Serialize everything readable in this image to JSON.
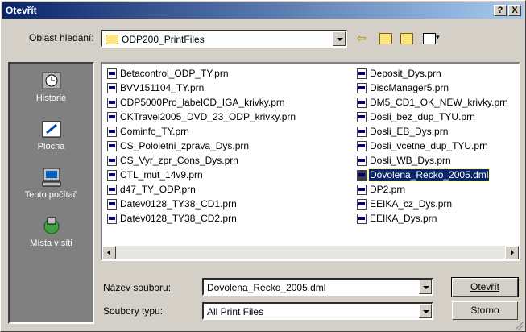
{
  "window": {
    "title": "Otevřít",
    "help": "?",
    "close": "X"
  },
  "lookin": {
    "label": "Oblast hledání:",
    "value": "ODP200_PrintFiles"
  },
  "places": [
    {
      "label": "Historie",
      "icon": "history-icon"
    },
    {
      "label": "Plocha",
      "icon": "desktop-icon"
    },
    {
      "label": "Tento počítač",
      "icon": "my-computer-icon"
    },
    {
      "label": "Místa v síti",
      "icon": "network-icon"
    }
  ],
  "files_col1": [
    "Betacontrol_ODP_TY.prn",
    "BVV151104_TY.prn",
    "CDP5000Pro_labelCD_IGA_krivky.prn",
    "CKTravel2005_DVD_23_ODP_krivky.prn",
    "Cominfo_TY.prn",
    "CS_Pololetni_zprava_Dys.prn",
    "CS_Vyr_zpr_Cons_Dys.prn",
    "CTL_mut_14v9.prn",
    "d47_TY_ODP.prn",
    "Datev0128_TY38_CD1.prn",
    "Datev0128_TY38_CD2.prn"
  ],
  "files_col2": [
    "Deposit_Dys.prn",
    "DiscManager5.prn",
    "DM5_CD1_OK_NEW_krivky.prn",
    "Dosli_bez_dup_TYU.prn",
    "Dosli_EB_Dys.prn",
    "Dosli_vcetne_dup_TYU.prn",
    "Dosli_WB_Dys.prn",
    "Dovolena_Recko_2005.dml",
    "DP2.prn",
    "EEIKA_cz_Dys.prn",
    "EEIKA_Dys.prn"
  ],
  "filename": {
    "label": "Název souboru:",
    "value": "Dovolena_Recko_2005.dml"
  },
  "filetype": {
    "label": "Soubory typu:",
    "value": "All Print Files"
  },
  "buttons": {
    "open": "Otevřít",
    "cancel": "Storno"
  },
  "colors": {
    "selection": "#0a246a",
    "title_start": "#0a246a",
    "title_end": "#a6caf0"
  }
}
